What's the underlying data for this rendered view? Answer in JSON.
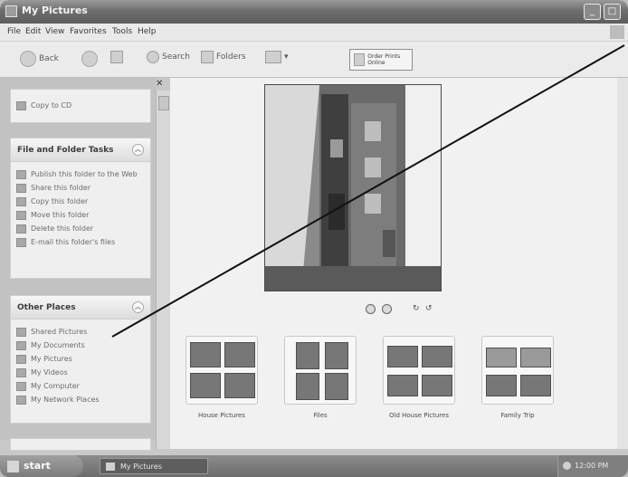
{
  "window": {
    "title": "My Pictures"
  },
  "menu": [
    "File",
    "Edit",
    "View",
    "Favorites",
    "Tools",
    "Help"
  ],
  "toolbar": {
    "back": "Back",
    "search": "Search",
    "folders": "Folders",
    "print_button": "Order Prints Online"
  },
  "taskpane": {
    "top_task": "Copy to CD",
    "file_folder": {
      "title": "File and Folder Tasks",
      "items": [
        "Publish this folder to the Web",
        "Share this folder",
        "Copy this folder",
        "Move this folder",
        "Delete this folder",
        "E-mail this folder's files"
      ]
    },
    "other_places": {
      "title": "Other Places",
      "items": [
        "Shared Pictures",
        "My Documents",
        "My Pictures",
        "My Videos",
        "My Computer",
        "My Network Places"
      ]
    }
  },
  "folders": [
    {
      "label": "House Pictures"
    },
    {
      "label": "Files"
    },
    {
      "label": "Old House Pictures"
    },
    {
      "label": "Family Trip"
    }
  ],
  "taskbar": {
    "start": "start",
    "task": "My Pictures",
    "clock": "12:00 PM"
  }
}
